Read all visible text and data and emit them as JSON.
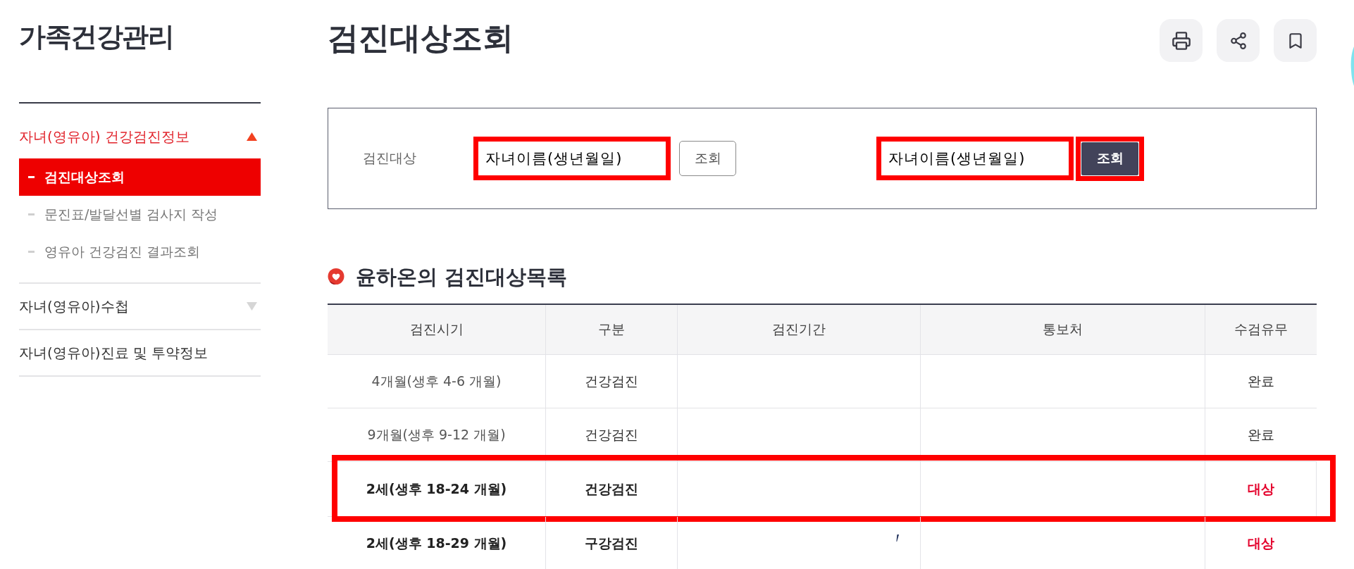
{
  "sidebar": {
    "title": "가족건강관리",
    "items": [
      {
        "label": "자녀(영유아) 건강검진정보",
        "kind": "group",
        "expanded": true,
        "children": [
          {
            "label": "검진대상조회",
            "selected": true
          },
          {
            "label": "문진표/발달선별 검사지 작성",
            "selected": false
          },
          {
            "label": "영유아 건강검진 결과조회",
            "selected": false
          }
        ]
      },
      {
        "label": "자녀(영유아)수첩",
        "kind": "group",
        "expanded": false
      },
      {
        "label": "자녀(영유아)진료 및 투약정보",
        "kind": "link"
      }
    ]
  },
  "page": {
    "title": "검진대상조회",
    "actions": [
      {
        "kind": "print"
      },
      {
        "kind": "share"
      },
      {
        "kind": "bookmark"
      }
    ]
  },
  "search": {
    "label": "검진대상",
    "groups": [
      {
        "field": {
          "value": "자녀이름(생년월일)",
          "annotated": true
        },
        "button": {
          "label": "조회",
          "kind": "outline",
          "annotated": false
        }
      },
      {
        "field": {
          "value": "자녀이름(생년월일)",
          "annotated": true
        },
        "button": {
          "label": "조회",
          "kind": "dark",
          "annotated": true
        }
      }
    ]
  },
  "list": {
    "title": "윤하온의 검진대상목록",
    "table": {
      "columns": [
        "검진시기",
        "구분",
        "검진기간",
        "통보처",
        "수검유무"
      ],
      "rows": [
        {
          "period": "4개월(생후 4-6 개월)",
          "category": "건강검진",
          "status": "완료",
          "due": false,
          "annotated": false
        },
        {
          "period": "9개월(생후 9-12 개월)",
          "category": "건강검진",
          "status": "완료",
          "due": false,
          "annotated": false
        },
        {
          "period": "2세(생후 18-24 개월)",
          "category": "건강검진",
          "status": "대상",
          "due": true,
          "annotated": true
        },
        {
          "period": "2세(생후 18-29 개월)",
          "category": "구강검진",
          "status": "대상",
          "due": true,
          "annotated": false
        }
      ]
    }
  }
}
